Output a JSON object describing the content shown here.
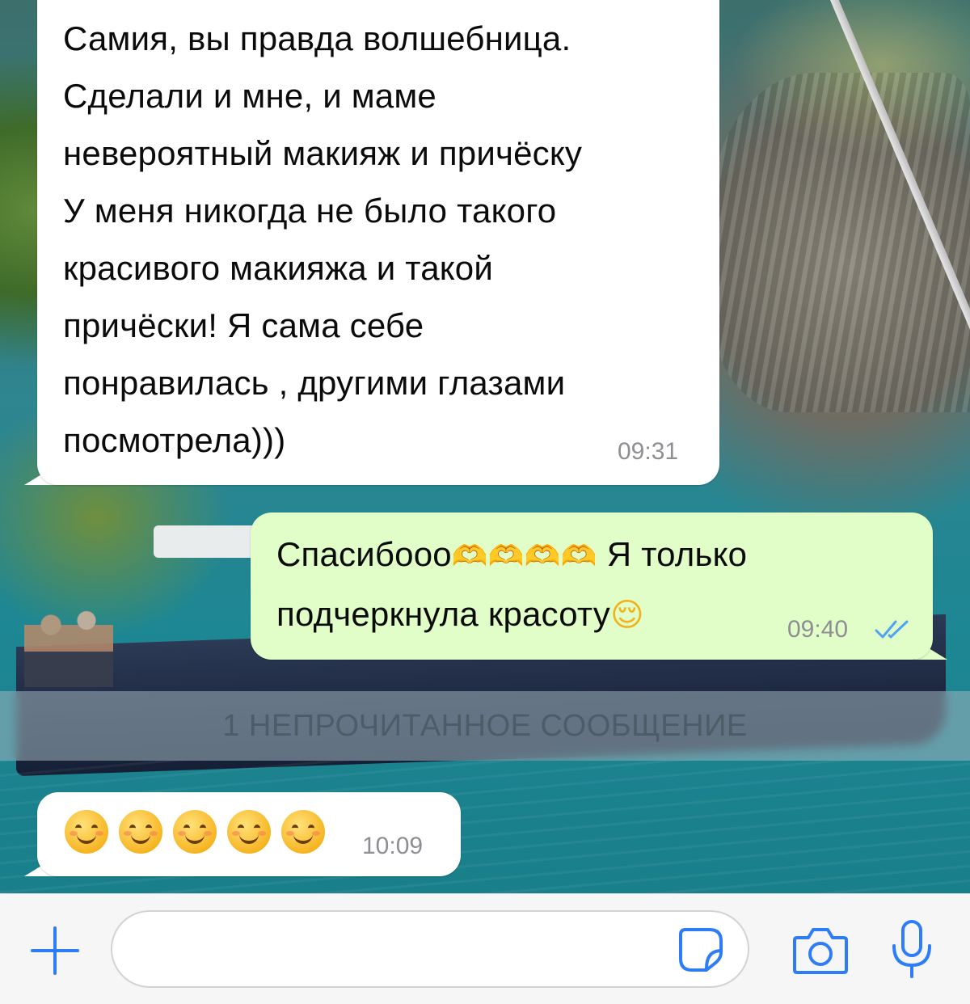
{
  "chat": {
    "messages": [
      {
        "direction": "incoming",
        "text": "Самия, вы правда волшебница.\nСделали и мне, и маме\nневероятный макияж и причёску\nУ меня никогда не было такого\nкрасивого макияжа и такой\nпричёски! Я сама себе\nпонравилась , другими глазами\nпосмотрела)))",
        "time": "09:31"
      },
      {
        "direction": "outgoing",
        "line1_text": "Спасибооо",
        "line1_emoji": "🫶🫶🫶🫶",
        "line1_tail": " Я только",
        "line2_text": "подчеркнула красоту",
        "line2_emoji": "😌",
        "time": "09:40",
        "status_icon": "double-check-read-icon"
      },
      {
        "direction": "incoming",
        "emoji_count": 5,
        "emoji_icon": "smiling-face-with-smiling-eyes-icon",
        "time": "10:09"
      }
    ],
    "unread_divider": "1 НЕПРОЧИТАННОЕ СООБЩЕНИЕ"
  },
  "toolbar": {
    "message_value": "",
    "icons": [
      "plus-icon",
      "sticker-icon",
      "camera-icon",
      "microphone-icon"
    ]
  },
  "colors": {
    "incoming_bubble": "#ffffff",
    "outgoing_bubble": "#e2fec8",
    "accent": "#2f7df6",
    "read_check": "#4da3f5"
  }
}
